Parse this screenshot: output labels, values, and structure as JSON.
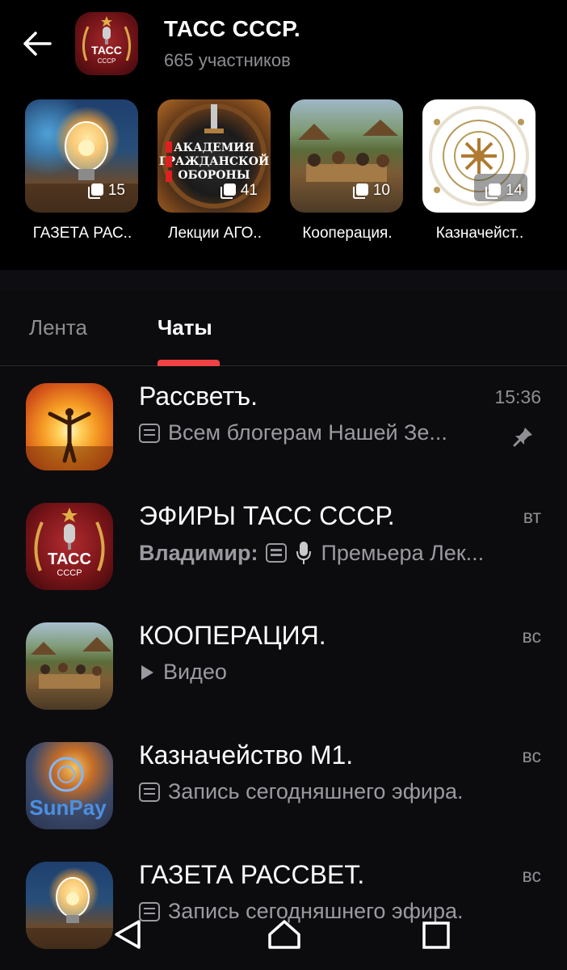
{
  "header": {
    "title": "ТАСС СССР.",
    "subtitle": "665 участников",
    "avatar_text": "ТАСС",
    "avatar_subtext": "СССР"
  },
  "albums": [
    {
      "label": "ГАЗЕТА РАС..",
      "count": "15"
    },
    {
      "label": "Лекции АГО..",
      "count": "41",
      "cover_text": [
        "АКАДЕМИЯ",
        "ГРАЖДАНСКОЙ",
        "ОБОРОНЫ"
      ]
    },
    {
      "label": "Кооперация.",
      "count": "10"
    },
    {
      "label": "Казначейст..",
      "count": "14"
    }
  ],
  "tabs": {
    "feed": "Лента",
    "chats": "Чаты"
  },
  "chats": [
    {
      "title": "Рассветъ.",
      "time": "15:36",
      "preview": "Всем блогерам Нашей Зе...",
      "pinned": true
    },
    {
      "title": "ЭФИРЫ ТАСС СССР.",
      "time": "вт",
      "sender": "Владимир:",
      "preview": "Премьера Лек...",
      "avatar_text": "ТАСС",
      "avatar_subtext": "СССР"
    },
    {
      "title": "КООПЕРАЦИЯ.",
      "time": "вс",
      "preview": "Видео"
    },
    {
      "title": "Казначейство М1.",
      "time": "вс",
      "preview": "Запись сегодняшнего эфира.",
      "avatar_text": "SunPay"
    },
    {
      "title": "ГАЗЕТА РАССВЕТ.",
      "time": "вс",
      "preview": "Запись сегодняшнего эфира."
    }
  ],
  "colors": {
    "accent": "#f04244",
    "background": "#0c0c0f",
    "muted_text": "#8e8e93"
  }
}
